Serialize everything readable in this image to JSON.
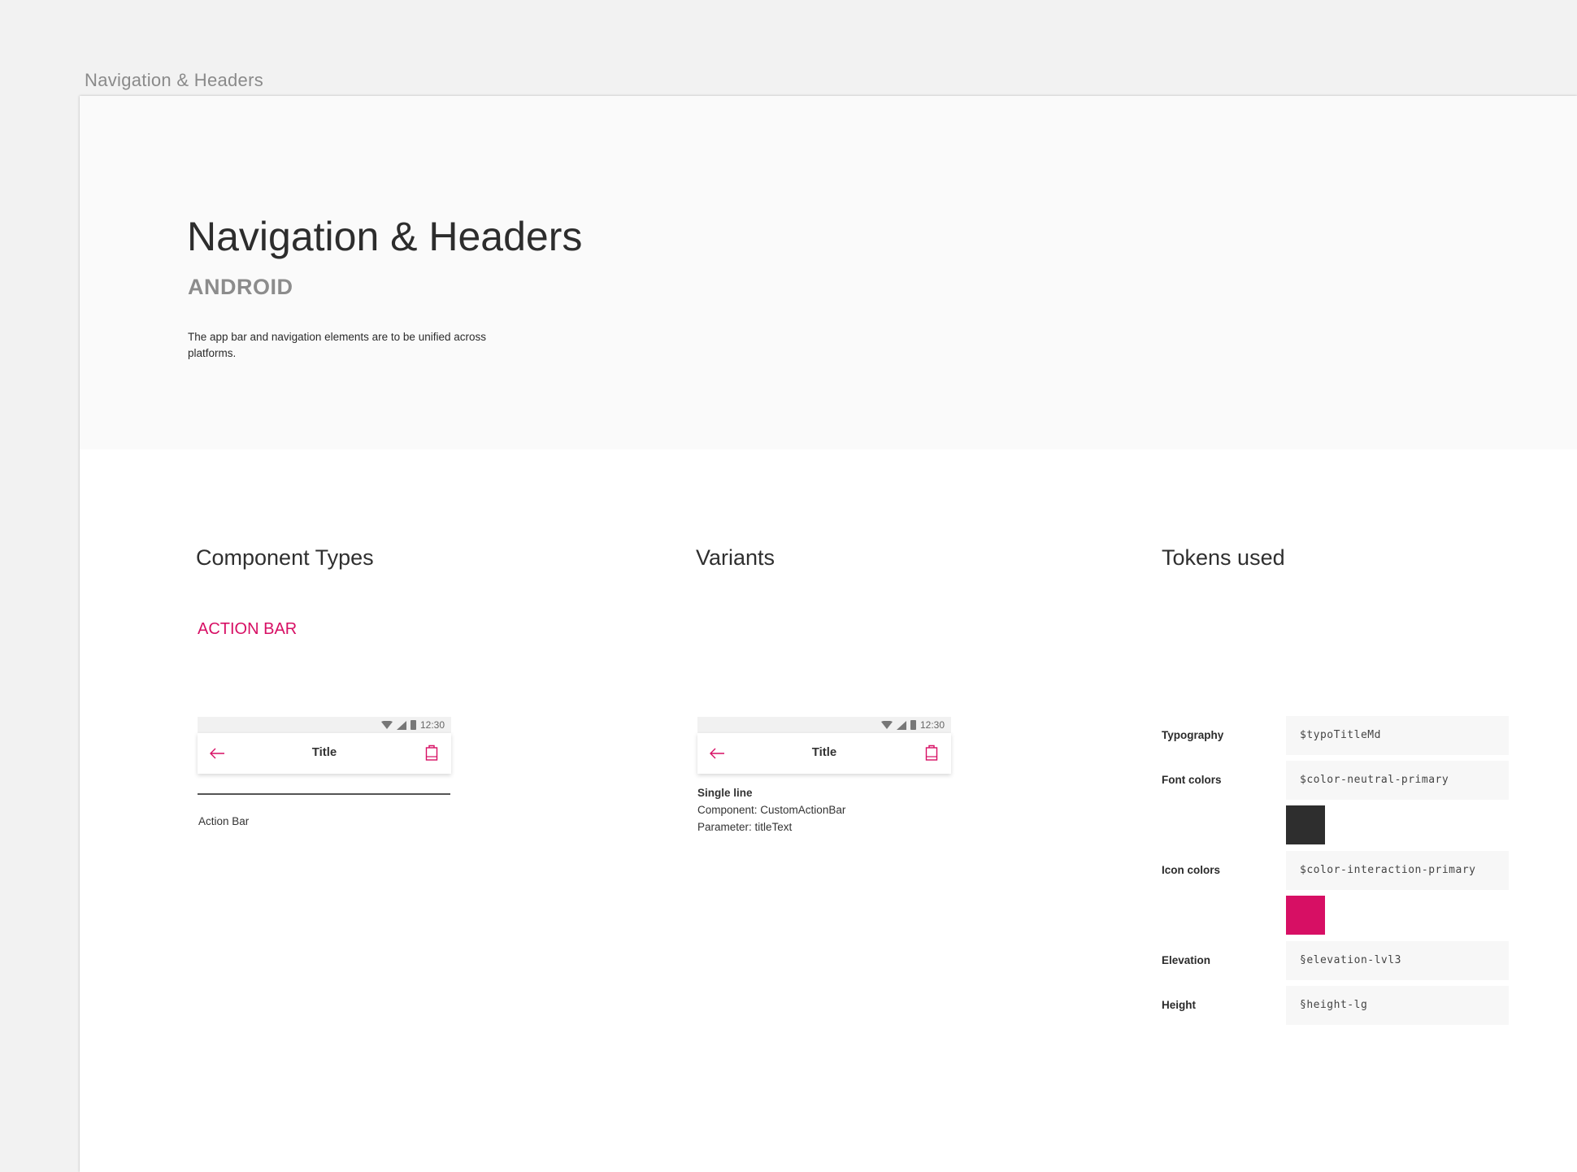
{
  "frame_label": "Navigation & Headers",
  "hero": {
    "title": "Navigation & Headers",
    "subtitle": "ANDROID",
    "description": "The app bar and navigation elements are to be unified across platforms."
  },
  "sections": {
    "component_types": "Component Types",
    "variants": "Variants",
    "tokens_used": "Tokens used"
  },
  "component_types": {
    "label": "ACTION BAR",
    "caption": "Action Bar"
  },
  "mock_bar": {
    "time": "12:30",
    "title": "Title"
  },
  "variants": {
    "name": "Single line",
    "component": "Component: CustomActionBar",
    "parameter": "Parameter: titleText"
  },
  "tokens": [
    {
      "label": "Typography",
      "value": "$typoTitleMd"
    },
    {
      "label": "Font colors",
      "value": "$color-neutral-primary",
      "swatch": "#2e2e2e"
    },
    {
      "label": "Icon colors",
      "value": "$color-interaction-primary",
      "swatch": "#d70f64"
    },
    {
      "label": "Elevation",
      "value": "§elevation-lvl3"
    },
    {
      "label": "Height",
      "value": "§height-lg"
    }
  ],
  "colors": {
    "accent": "#d70f64",
    "text_primary": "#2e2e2e",
    "hero_background": "#fafafa",
    "canvas_background": "#f2f2f2"
  },
  "icons": [
    "back-arrow-icon",
    "shopping-bag-icon",
    "wifi-icon",
    "signal-icon",
    "battery-icon"
  ]
}
